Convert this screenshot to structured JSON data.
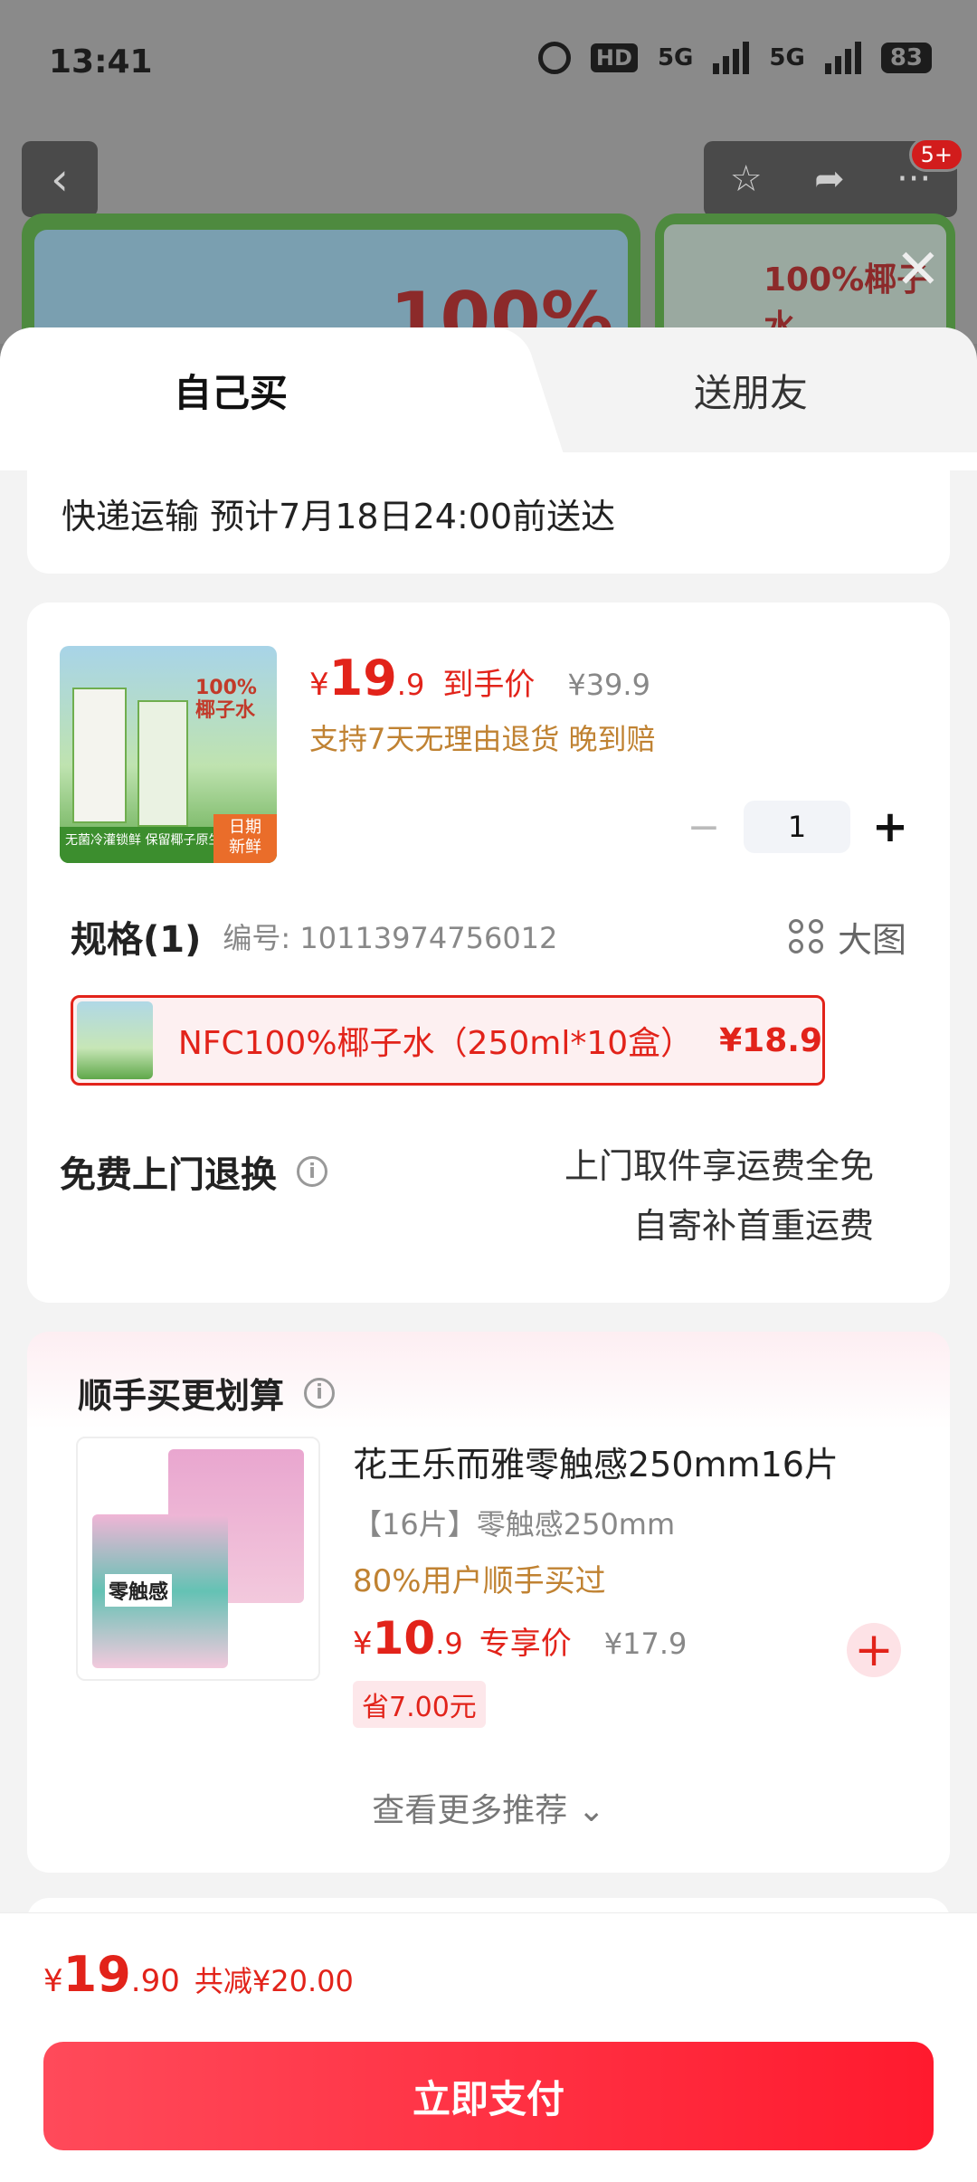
{
  "status_bar": {
    "time": "13:41",
    "hd": "HD",
    "net1": "5G",
    "net2": "5G",
    "battery": "83"
  },
  "background": {
    "badge": "5+",
    "banner_text": "100%",
    "banner2_text": "100%椰子水"
  },
  "tabs": {
    "self": "自己买",
    "gift": "送朋友"
  },
  "delivery": {
    "text": "快递运输 预计7月18日24:00前送达"
  },
  "product": {
    "price_currency": "¥",
    "price_int": "19",
    "price_dec": ".9",
    "price_tag": "到手价",
    "original_price": "¥39.9",
    "support": "支持7天无理由退货  晚到赔",
    "quantity": "1",
    "thumb_brand": "100%\n椰子水",
    "thumb_stripe": "无菌冷灌锁鲜 保留椰子原生风味",
    "thumb_fresh": "日期\n新鲜"
  },
  "spec": {
    "title": "规格(1)",
    "code_label": "编号: 10113974756012",
    "big_image": "大图",
    "option_name": "NFC100%椰子水（250ml*10盒）",
    "option_price": "¥18.9"
  },
  "returns": {
    "title": "免费上门退换",
    "line1": "上门取件享运费全免",
    "line2": "自寄补首重运费"
  },
  "recommend": {
    "title": "顺手买更划算",
    "name": "花王乐而雅零触感250mm16片",
    "spec": "【16片】零触感250mm",
    "users": "80%用户顺手买过",
    "price_currency": "¥",
    "price_int": "10",
    "price_dec": ".9",
    "price_tag": "专享价",
    "original_price": "¥17.9",
    "save": "省7.00元",
    "thumb_label": "零触感",
    "more": "查看更多推荐 ⌄"
  },
  "bottom": {
    "currency": "¥",
    "total_int": "19",
    "total_dec": ".90",
    "saved": "共减¥20.00",
    "pay": "立即支付"
  }
}
